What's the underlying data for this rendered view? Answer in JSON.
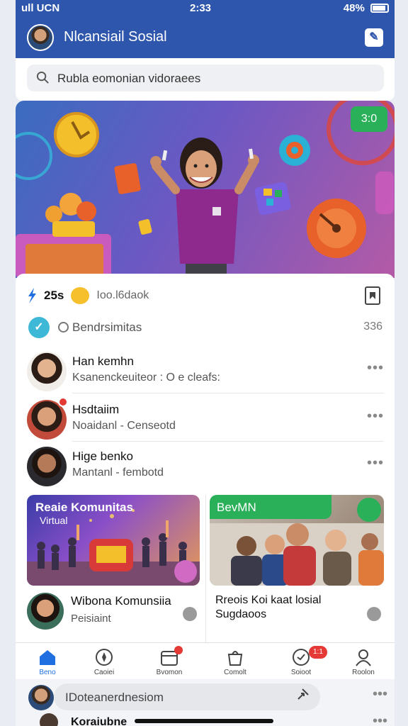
{
  "status_bar": {
    "carrier": "ull UCN",
    "time": "2:33",
    "battery": "48%"
  },
  "header": {
    "title": "Nlcansiail Sosial",
    "edit_icon": "edit-icon"
  },
  "search": {
    "placeholder": "Rubla eomonian vidoraees"
  },
  "hero": {
    "badge": "3:0"
  },
  "post": {
    "count": "25s",
    "reaction_label": "Ioo.l6daok",
    "friend_requests_label": "Bendrsimitas",
    "friend_requests_count": "336"
  },
  "friends": [
    {
      "name": "Han kemhn",
      "sub": "Ksanenckeuiteor : O e cleafs:"
    },
    {
      "name": "Hsdtaiim",
      "sub": "Noaidanl - Censeotd"
    },
    {
      "name": "Hige benko",
      "sub": "Mantanl - fembotd"
    }
  ],
  "tiles": [
    {
      "title": "Reaie Komunitas",
      "subtitle": "Virtual",
      "caption": "Wibona Komunsiia",
      "sub": "Peisiaint"
    },
    {
      "title": "BevMN",
      "caption": "Rreois Koi kaat losial",
      "sub": "Sugdaoos"
    }
  ],
  "nav": [
    {
      "label": "Beno",
      "icon": "home-icon"
    },
    {
      "label": "Caoiei",
      "icon": "compass-icon"
    },
    {
      "label": "Bvomon",
      "icon": "calendar-icon"
    },
    {
      "label": "Comolt",
      "icon": "bag-icon"
    },
    {
      "label": "Soioot",
      "icon": "chat-icon",
      "badge": "1:1"
    },
    {
      "label": "Roolon",
      "icon": "profile-icon"
    }
  ],
  "compose": {
    "placeholder": "IDoteanerdnesiom",
    "peek_text": "Koraiubne"
  }
}
